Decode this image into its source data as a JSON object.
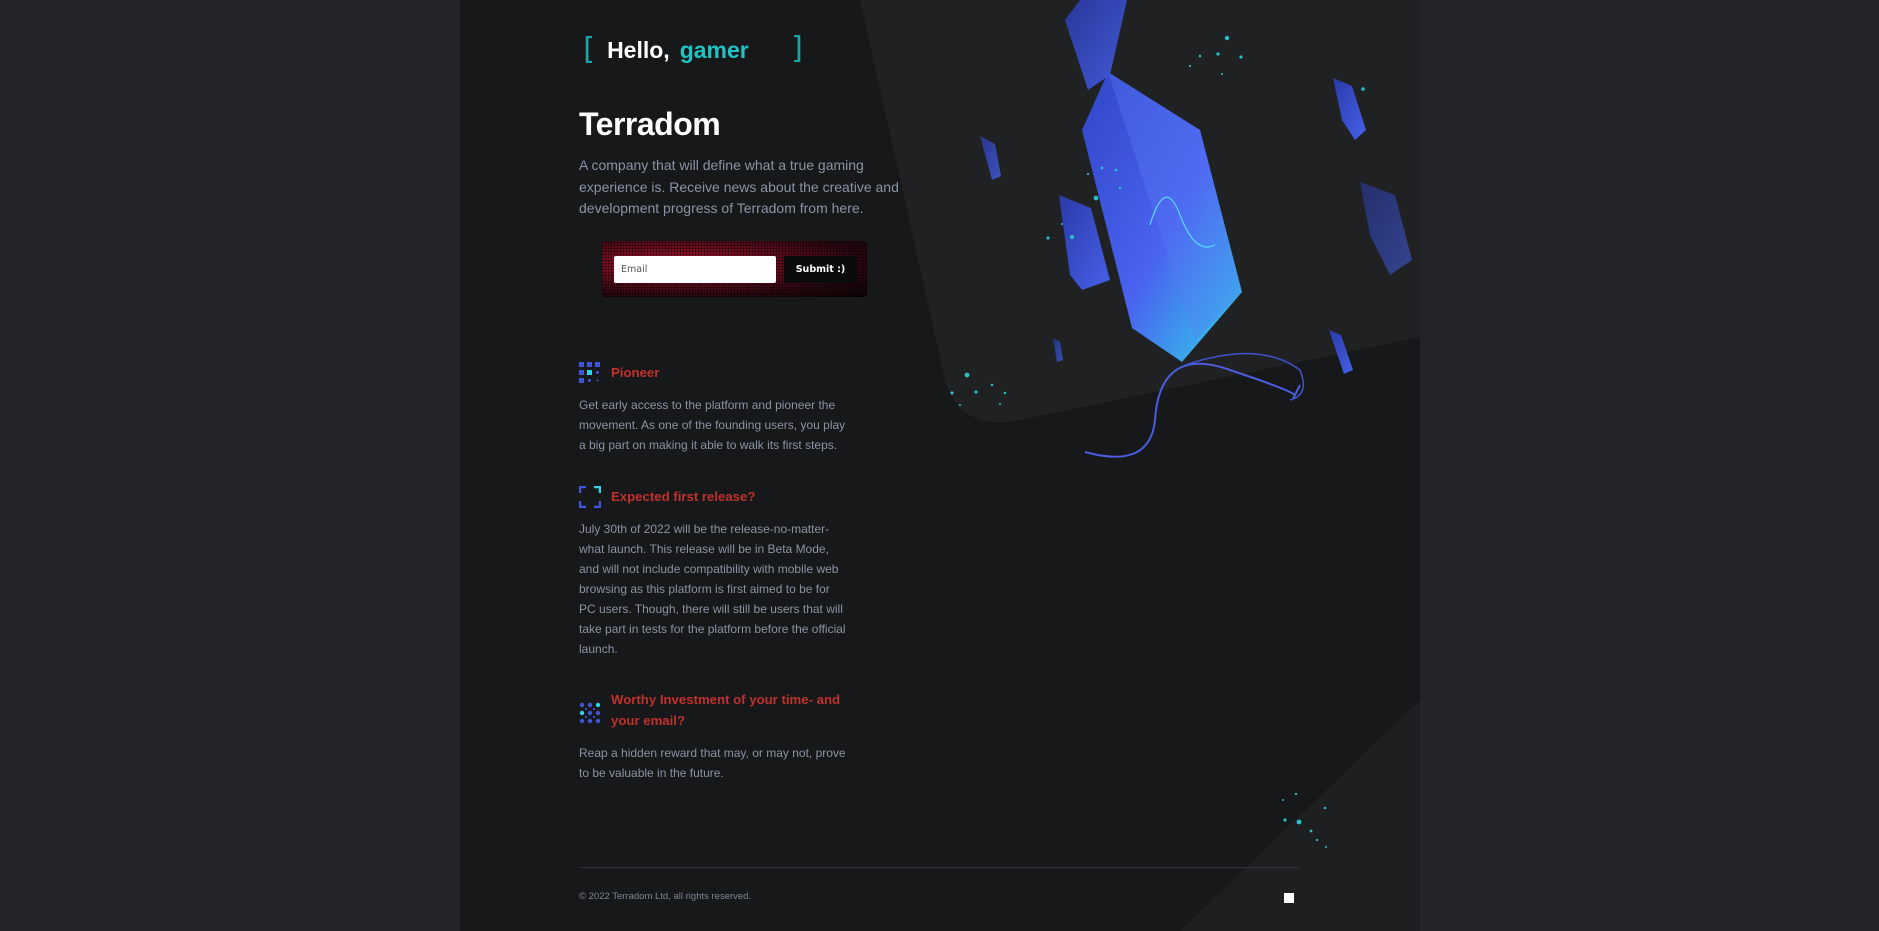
{
  "greeting": {
    "open_bracket": "[",
    "hello": "Hello,",
    "name": "gamer",
    "close_bracket": "]"
  },
  "title": "Terradom",
  "intro": "A company that will define what a true gaming experience is. Receive news about the creative and development progress of Terradom from here.",
  "signup": {
    "placeholder": "Email",
    "submit_label": "Submit :)"
  },
  "features": [
    {
      "icon": "grid-dots-icon",
      "heading": "Pioneer",
      "body": "Get early access to the platform and pioneer the movement. As one of the founding users, you play a big part on making it able to walk its first steps."
    },
    {
      "icon": "focus-frame-icon",
      "heading": "Expected first release?",
      "body": "July 30th of 2022 will be the release-no-matter-what launch. This release will be in Beta Mode, and will not include compatibility with mobile web browsing as this platform is first aimed to be for PC users. Though, there will still be users that will take part in tests for the platform before the official launch."
    },
    {
      "icon": "dot-matrix-icon",
      "heading": "Worthy Investment of your time- and your email?",
      "body": "Reap a hidden reward that may, or may not, prove to be valuable in the future."
    }
  ],
  "footer": {
    "copyright": "© 2022 Terradom Ltd, all rights reserved."
  },
  "colors": {
    "accent_teal": "#22c2c2",
    "accent_red": "#c0312c",
    "crystal_blue": "#3f55e0"
  }
}
